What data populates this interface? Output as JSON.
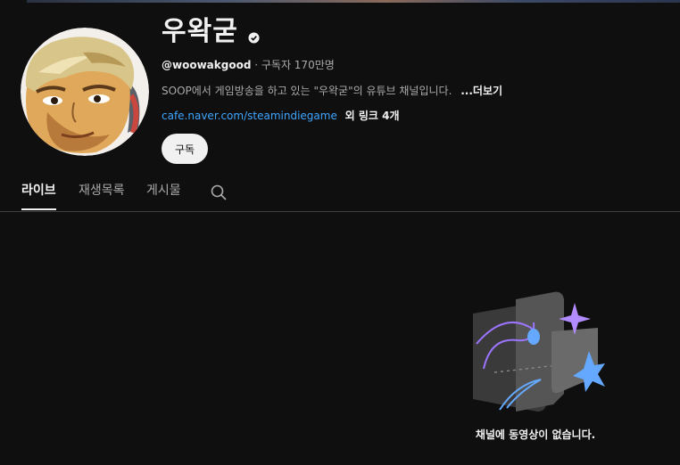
{
  "channel": {
    "name": "우왁굳",
    "handle": "@woowakgood",
    "subscribers": "· 구독자 170만명",
    "description": "SOOP에서 게임방송을 하고 있는 \"우왁굳\"의 유튜브 채널입니다.",
    "more_label": "...더보기",
    "link_text": "cafe.naver.com/steamindiegame",
    "extra_links": "외 링크 4개",
    "subscribe_label": "구독",
    "verified_icon": "verified-check-icon",
    "avatar_icon": "channel-avatar"
  },
  "tabs": [
    {
      "label": "라이브",
      "active": true
    },
    {
      "label": "재생목록",
      "active": false
    },
    {
      "label": "게시물",
      "active": false
    }
  ],
  "search_icon": "search-icon",
  "empty_state": {
    "message": "채널에 동영상이 없습니다.",
    "illustration": "empty-channel-illustration"
  },
  "colors": {
    "background": "#0f0f0f",
    "text_primary": "#f1f1f1",
    "text_secondary": "#aaaaaa",
    "link": "#3ea6ff",
    "divider": "#3f3f3f"
  }
}
